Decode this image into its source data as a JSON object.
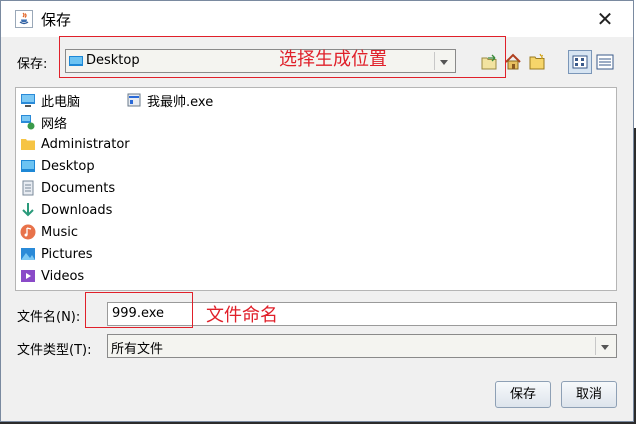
{
  "window": {
    "title": "保存"
  },
  "save_in": {
    "label": "保存:",
    "value": "Desktop"
  },
  "files": [
    {
      "name": "此电脑",
      "icon": "computer-icon"
    },
    {
      "name": "网络",
      "icon": "network-icon"
    },
    {
      "name": "Administrator",
      "icon": "folder-icon"
    },
    {
      "name": "Desktop",
      "icon": "desktop-icon"
    },
    {
      "name": "Documents",
      "icon": "documents-icon"
    },
    {
      "name": "Downloads",
      "icon": "downloads-icon"
    },
    {
      "name": "Music",
      "icon": "music-icon"
    },
    {
      "name": "Pictures",
      "icon": "pictures-icon"
    },
    {
      "name": "Videos",
      "icon": "videos-icon"
    },
    {
      "name": "我最帅.exe",
      "icon": "exe-file-icon"
    }
  ],
  "filename": {
    "label": "文件名(N):",
    "value": "999.exe"
  },
  "filetype": {
    "label": "文件类型(T):",
    "value": "所有文件"
  },
  "buttons": {
    "save": "保存",
    "cancel": "取消"
  },
  "annotations": {
    "location": "选择生成位置",
    "naming": "文件命名"
  },
  "colors": {
    "annotation_red": "#e0202a",
    "dialog_bg": "#f0f0f0"
  }
}
